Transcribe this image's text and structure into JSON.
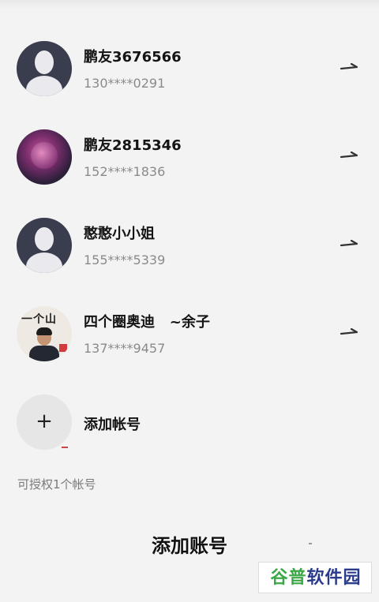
{
  "top_fragment": "-  -  -  -",
  "accounts": [
    {
      "name": "鹏友3676566",
      "phone": "130****0291",
      "avatar": "default-avatar"
    },
    {
      "name": "鹏友2815346",
      "phone": "152****1836",
      "avatar": "photo-avatar"
    },
    {
      "name": "憨憨小小姐",
      "phone": "155****5339",
      "avatar": "default-avatar"
    },
    {
      "name": "四个圈奥迪   ~余子",
      "phone": "137****9457",
      "avatar": "photo-avatar"
    }
  ],
  "add_account": {
    "icon": "+",
    "label": "添加帐号"
  },
  "footer_note": "可授权1个帐号",
  "subtitle": "添加账号",
  "watermark": {
    "part1": "谷普",
    "part2": "软件园"
  },
  "colors": {
    "background": "#f3f3f3",
    "text_primary": "#141414",
    "text_secondary": "#8a8a8a",
    "default_avatar_bg": "#3a3d4e",
    "watermark_green": "#3aa844",
    "watermark_blue": "#2b3b8c"
  }
}
